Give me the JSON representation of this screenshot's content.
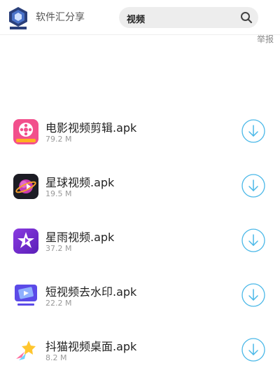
{
  "header": {
    "site_name": "软件汇分享",
    "search_value": "视频",
    "report_label": "举报"
  },
  "apps": [
    {
      "name": "电影视频剪辑.apk",
      "size": "79.2 M",
      "icon": "film-reel-icon"
    },
    {
      "name": "星球视频.apk",
      "size": "19.5 M",
      "icon": "planet-icon"
    },
    {
      "name": "星雨视频.apk",
      "size": "37.2 M",
      "icon": "star-icon"
    },
    {
      "name": "短视频去水印.apk",
      "size": "22.2 M",
      "icon": "video-watermark-icon"
    },
    {
      "name": "抖猫视频桌面.apk",
      "size": "8.2 M",
      "icon": "shooting-star-icon"
    }
  ],
  "colors": {
    "download_accent": "#4ab8e8"
  }
}
